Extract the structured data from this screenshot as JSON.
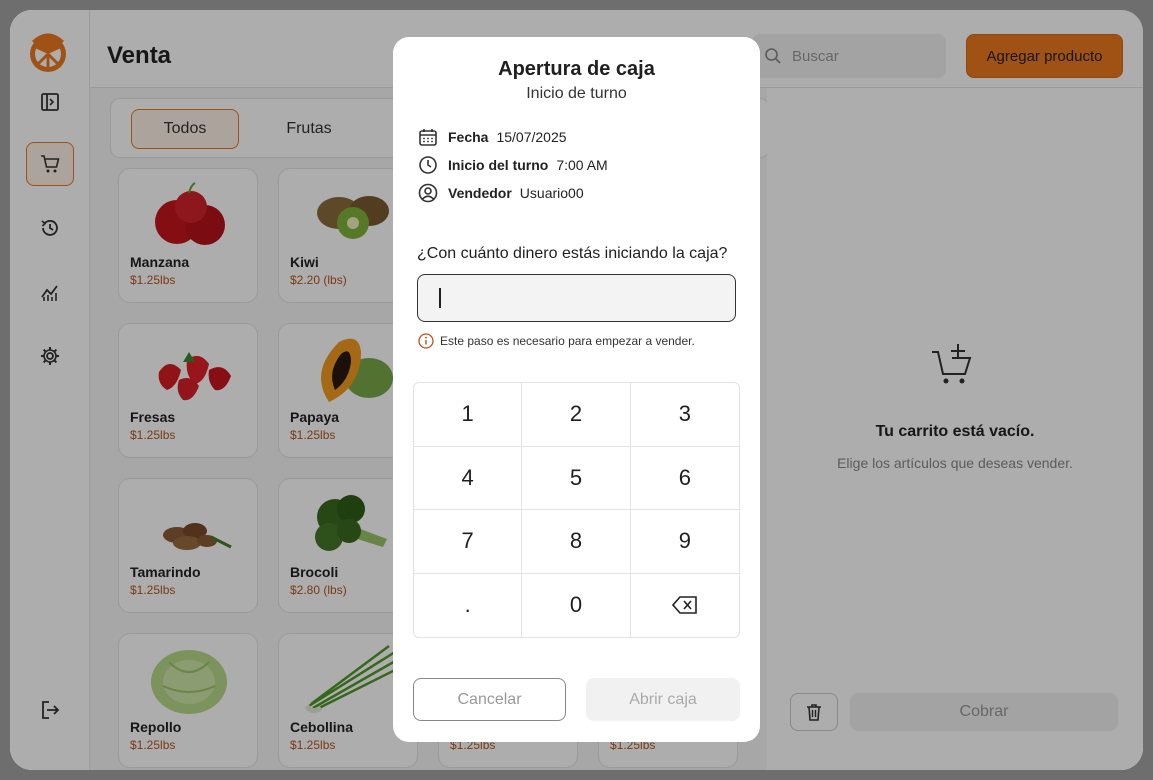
{
  "header": {
    "title": "Venta",
    "search_placeholder": "Buscar",
    "add_product_label": "Agregar producto"
  },
  "categories": {
    "active": "Todos",
    "second": "Frutas"
  },
  "products": [
    {
      "name": "Manzana",
      "price": "$1.25lbs",
      "icon": "apple-image"
    },
    {
      "name": "Kiwi",
      "price": "$2.20 (lbs)",
      "icon": "kiwi-image"
    },
    {
      "name": "Fresas",
      "price": "$1.25lbs",
      "icon": "strawberries-image"
    },
    {
      "name": "Papaya",
      "price": "$1.25lbs",
      "icon": "papaya-image"
    },
    {
      "name": "Tamarindo",
      "price": "$1.25lbs",
      "icon": "tamarind-image"
    },
    {
      "name": "Brocoli",
      "price": "$2.80 (lbs)",
      "icon": "broccoli-image"
    },
    {
      "name": "Repollo",
      "price": "$1.25lbs",
      "icon": "cabbage-image"
    },
    {
      "name": "Cebollina",
      "price": "$1.25lbs",
      "icon": "chives-image"
    }
  ],
  "hidden_prices": [
    "$1.25lbs",
    "$1.25lbs"
  ],
  "cart": {
    "empty_title": "Tu carrito está vacío.",
    "empty_subtitle": "Elige los artículos que deseas vender.",
    "charge_label": "Cobrar"
  },
  "modal": {
    "title": "Apertura de caja",
    "subtitle": "Inicio de turno",
    "date_label": "Fecha",
    "date_value": "15/07/2025",
    "shift_label": "Inicio del turno",
    "shift_value": "7:00 AM",
    "seller_label": "Vendedor",
    "seller_value": "Usuario00",
    "question": "¿Con cuánto dinero estás iniciando la caja?",
    "amount_value": "",
    "hint": "Este paso es necesario para empezar a vender.",
    "keys": [
      "1",
      "2",
      "3",
      "4",
      "5",
      "6",
      "7",
      "8",
      "9",
      ".",
      "0"
    ],
    "cancel_label": "Cancelar",
    "open_label": "Abrir caja"
  },
  "colors": {
    "accent": "#ea7a1e",
    "price": "#b3541e"
  }
}
